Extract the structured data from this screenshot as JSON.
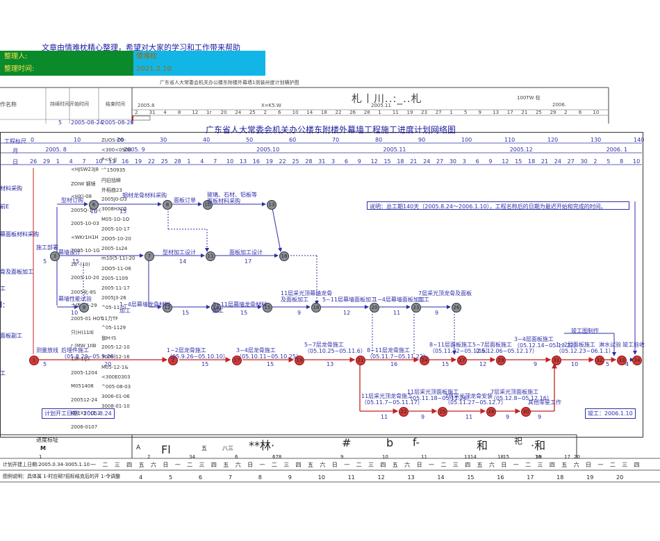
{
  "notice": "文章由情难枕精心整理，希望对大家的学习和工作带来帮助",
  "meta": {
    "organizer_label": "整理人:",
    "organizer_value": "情难枕",
    "time_label": "整理时间:",
    "time_value": "2021.2.10"
  },
  "scan_header": {
    "title": "广东省人大常委会机关办公楼东附楼外幕墙1测装卅度计划横护图",
    "col_task": "作名称",
    "col_duration": "持续时间",
    "col_start": "开始时间",
    "col_end": "结束时间",
    "month_a": "2005.8",
    "month_b": "X=K5.W",
    "month_c": "2005.11",
    "big_text": "札丨川..:_..札",
    "right_text": "100TW 棯",
    "year_right": "2006.",
    "row1_duration": "5",
    "row1_start": "2005-08-24",
    "row1_end": "2005-08-28",
    "day_row": [
      "2",
      "31",
      "4",
      "8",
      "12",
      "1r",
      "20",
      "24",
      "25",
      "2",
      "6",
      "10",
      "14",
      "18",
      "22",
      "26",
      "28",
      "1",
      "11",
      "19",
      "23",
      "27",
      "1",
      "5",
      "9",
      "13",
      "17",
      "21",
      "25",
      "29",
      "2",
      "6",
      "10"
    ]
  },
  "chart": {
    "title": "广东省人大常委会机关办公楼东附楼外幕墙工程施工进度计划网络图",
    "row_labels": {
      "scale": "工程标尺",
      "month": "月",
      "day": "日"
    },
    "scale_ticks": [
      "0",
      "10",
      "20",
      "30",
      "40",
      "50",
      "60",
      "70",
      "80",
      "90",
      "100",
      "110",
      "120",
      "130",
      "140"
    ],
    "months": [
      "2005. 8",
      "2005. 9",
      "2005.10",
      "2005.11",
      "2005.12",
      "2006. 1"
    ],
    "days": [
      "26",
      "29",
      "1",
      "4",
      "7",
      "10",
      "13",
      "16",
      "19",
      "22",
      "25",
      "28",
      "1",
      "4",
      "7",
      "10",
      "13",
      "16",
      "19",
      "22",
      "25",
      "28",
      "31",
      "3",
      "6",
      "9",
      "12",
      "15",
      "18",
      "21",
      "24",
      "27",
      "30",
      "3",
      "6",
      "9",
      "12",
      "15",
      "18",
      "21",
      "24",
      "27",
      "30",
      "2",
      "5",
      "8",
      "10"
    ],
    "left_labels": [
      "材料采购",
      "前E",
      "幕面板材料采购",
      "骨及面板加工",
      "工",
      "I:",
      "面板副工",
      "工"
    ],
    "note": "说明：总工期140天（2005.8.24～2006.1.10），工程名称后的日期为最迟开始和完成的时间。",
    "plan_start": "计划开工日期：2005.8.24",
    "completion": "竣工：2006.1.10",
    "acceptance": "竣工验收",
    "activities": [
      {
        "text": "型材订购",
        "dur": "10"
      },
      {
        "text": "钢材龙骨材料采购",
        "dur": "15"
      },
      {
        "text": "面板订单",
        "dur": ""
      },
      {
        "text": "玻璃、石材、铝板等面板材料采购",
        "dur": ""
      },
      {
        "text": "施工部署",
        "dur": "5"
      },
      {
        "text": "幕墙设计",
        "dur": "15"
      },
      {
        "text": "型材加工设计",
        "dur": "14"
      },
      {
        "text": "面板加工设计",
        "dur": "17"
      },
      {
        "text": "幕墙性能试验",
        "dur": "10"
      },
      {
        "text": "1~4层幕墙龙骨材料加工",
        "dur": "15"
      },
      {
        "text": "5~11层幕墙龙骨材料加工",
        "dur": "15"
      },
      {
        "text": "11层采光顶幕墙龙骨及面板加工",
        "dur": "9"
      },
      {
        "text": "5~11层幕墙面板加工",
        "dur": "12"
      },
      {
        "text": "1~4层幕墙面板加工",
        "dur": "11"
      },
      {
        "text": "7层采光顶龙骨及面板加工",
        "dur": "9"
      },
      {
        "text": "测量放线",
        "dur": "5"
      },
      {
        "text": "后埋件施工（05.8.29~05.9.20）",
        "dur": "20"
      },
      {
        "text": "1~2层龙骨施工（05.9.26~05.10.10）",
        "dur": "15"
      },
      {
        "text": "3~4层龙骨施工（05.10.11~05.10.25）",
        "dur": "15"
      },
      {
        "text": "5~7层龙骨施工（05.10.25~05.11.6）",
        "dur": "13"
      },
      {
        "text": "8~11层龙骨施工（05.11.7~05.11.22）",
        "dur": "16"
      },
      {
        "text": "8~11层面板施工（05.11.22~05.12.6）",
        "dur": "15"
      },
      {
        "text": "5~7层面板施工（05.12.06~05.12.17）",
        "dur": "12"
      },
      {
        "text": "3~4层面板施工（05.12.14~05.12.22）",
        "dur": "9"
      },
      {
        "text": "1~2层面板施工（05.12.23~06.1.1）",
        "dur": "10"
      },
      {
        "text": "淋水试验",
        "dur": "5"
      },
      {
        "text": "竣工验收",
        "dur": "4"
      },
      {
        "text": "11层采光顶龙骨施工（05.11.7~05.11.17）",
        "dur": "11"
      },
      {
        "text": "11层采光顶面板施工（05.11.18~05.11.26）",
        "dur": "9"
      },
      {
        "text": "7层采光顶龙骨安装（05.11.27~05.12.7）",
        "dur": "11"
      },
      {
        "text": "7层采光顶面板施工（05.12.8~05.12.16）",
        "dur": "9"
      },
      {
        "text": "其他零星工作",
        "dur": "9"
      },
      {
        "text": "竣工图制作",
        "dur": ""
      }
    ],
    "scan_col_left": [
      "<HJSW23J8",
      "ZOIW 钢镜",
      "<HX)-08",
      "2005Q-1-)|-(",
      "2005-10-03",
      "<WKr1H1H",
      "2005-10-1G",
      "26'-(10)",
      "2005-10-20",
      "2005化-8S",
      "土体 1G-29",
      "2005-01 HOT",
      "只(H)11IE",
      "r (MW 1IIB",
      "1)R-1IJ3",
      "2005-1204",
      "M051408",
      "200512-24",
      "K01X5^(1 1",
      "2006-0107"
    ],
    "scan_col_right": [
      "ZUOS-O9-",
      "<300<0908",
      "P<C-JJ",
      "'^150935",
      "円旧括瞬",
      "外稻曲23",
      "2005J0-D3",
      "3008HX05",
      "M05-1O-1O",
      "2005-10-17",
      "2OO5-10-20",
      "2005-1s24",
      "m10(5-11)-20",
      "2OO5-11-06",
      "2005-1109",
      "2005-11-17",
      "2005J3-26",
      "^05-11-0)",
      "11力TF",
      "^05-1129",
      "伽H-IS",
      "2005-12-10",
      "3008-12-16",
      "M05-12-1&",
      "<300E0303",
      "^005-08-03",
      "3006-01-06",
      "3008-01-10"
    ]
  },
  "bottom": {
    "progress_label": "进度标址",
    "m_label": "M",
    "col_a": "A",
    "col_fl": "Fl",
    "col_ck": "五",
    "col_ws": "八三",
    "big_chars": "**林·",
    "num_h": "#",
    "col_b": "b",
    "col_f": "f-",
    "col_he": "和",
    "col_huo": "祀",
    "col_he2": "·和",
    "plan_line": "计划开建丄日期:2005.0.34-3005.1.10",
    "legend_line": "图例说明：具体属 1-时应砌?招标结克后的开 1-令调整",
    "week_row": [
      "一",
      "二",
      "三",
      "四",
      "五",
      "六",
      "日",
      "一",
      "二",
      "三",
      "四",
      "五",
      "六",
      "日",
      "一",
      "二",
      "三",
      "四",
      "五",
      "六",
      "日",
      "一",
      "二",
      "三",
      "四",
      "五",
      "六",
      "日",
      "一",
      "二",
      "三",
      "四",
      "五",
      "六",
      "日",
      "一",
      "二",
      "三",
      "四",
      "五",
      "六",
      "日",
      "一",
      "二",
      "三",
      "四"
    ],
    "week_nums": [
      "4",
      "5",
      "6",
      "7",
      "8",
      "9",
      "10",
      "11",
      "12",
      "13",
      "14",
      "15",
      "16",
      "17",
      "18",
      "19",
      "20"
    ],
    "mid_nums": [
      "1",
      "2",
      "34",
      "6",
      "678",
      "9",
      "10",
      "11",
      "1314",
      "15",
      "16",
      "17",
      "18",
      "19",
      "20"
    ]
  }
}
